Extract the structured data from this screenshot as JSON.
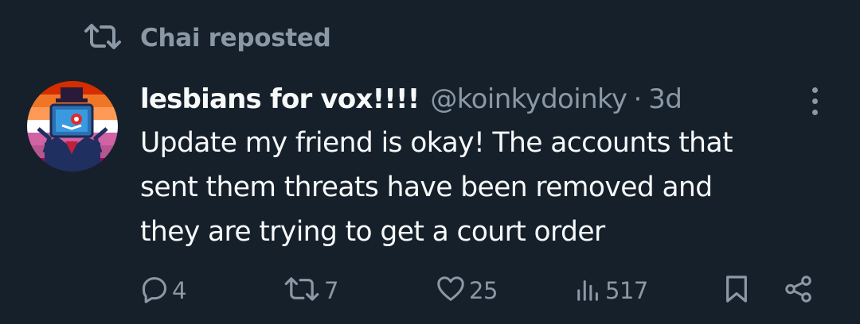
{
  "repost": {
    "label": "Chai reposted",
    "icon": "repost-icon"
  },
  "post": {
    "display_name": "lesbians for vox!!!!",
    "handle": "@koinkydoinky",
    "separator": "·",
    "time": "3d",
    "avatar": {
      "description_icon": "avatar",
      "flag_colors": [
        "#d52d00",
        "#ef7627",
        "#ff9a56",
        "#ffffff",
        "#d162a4",
        "#b55690",
        "#a30262"
      ]
    },
    "text_lines": [
      "Update my friend is okay! The accounts that",
      "sent them threats have been removed and",
      "they are trying to get a court order"
    ]
  },
  "actions": {
    "reply_count": "4",
    "repost_count": "7",
    "like_count": "25",
    "views_count": "517"
  },
  "colors": {
    "background": "#15202b",
    "primary_text": "#f7f9f9",
    "secondary_text": "#8b98a5"
  }
}
